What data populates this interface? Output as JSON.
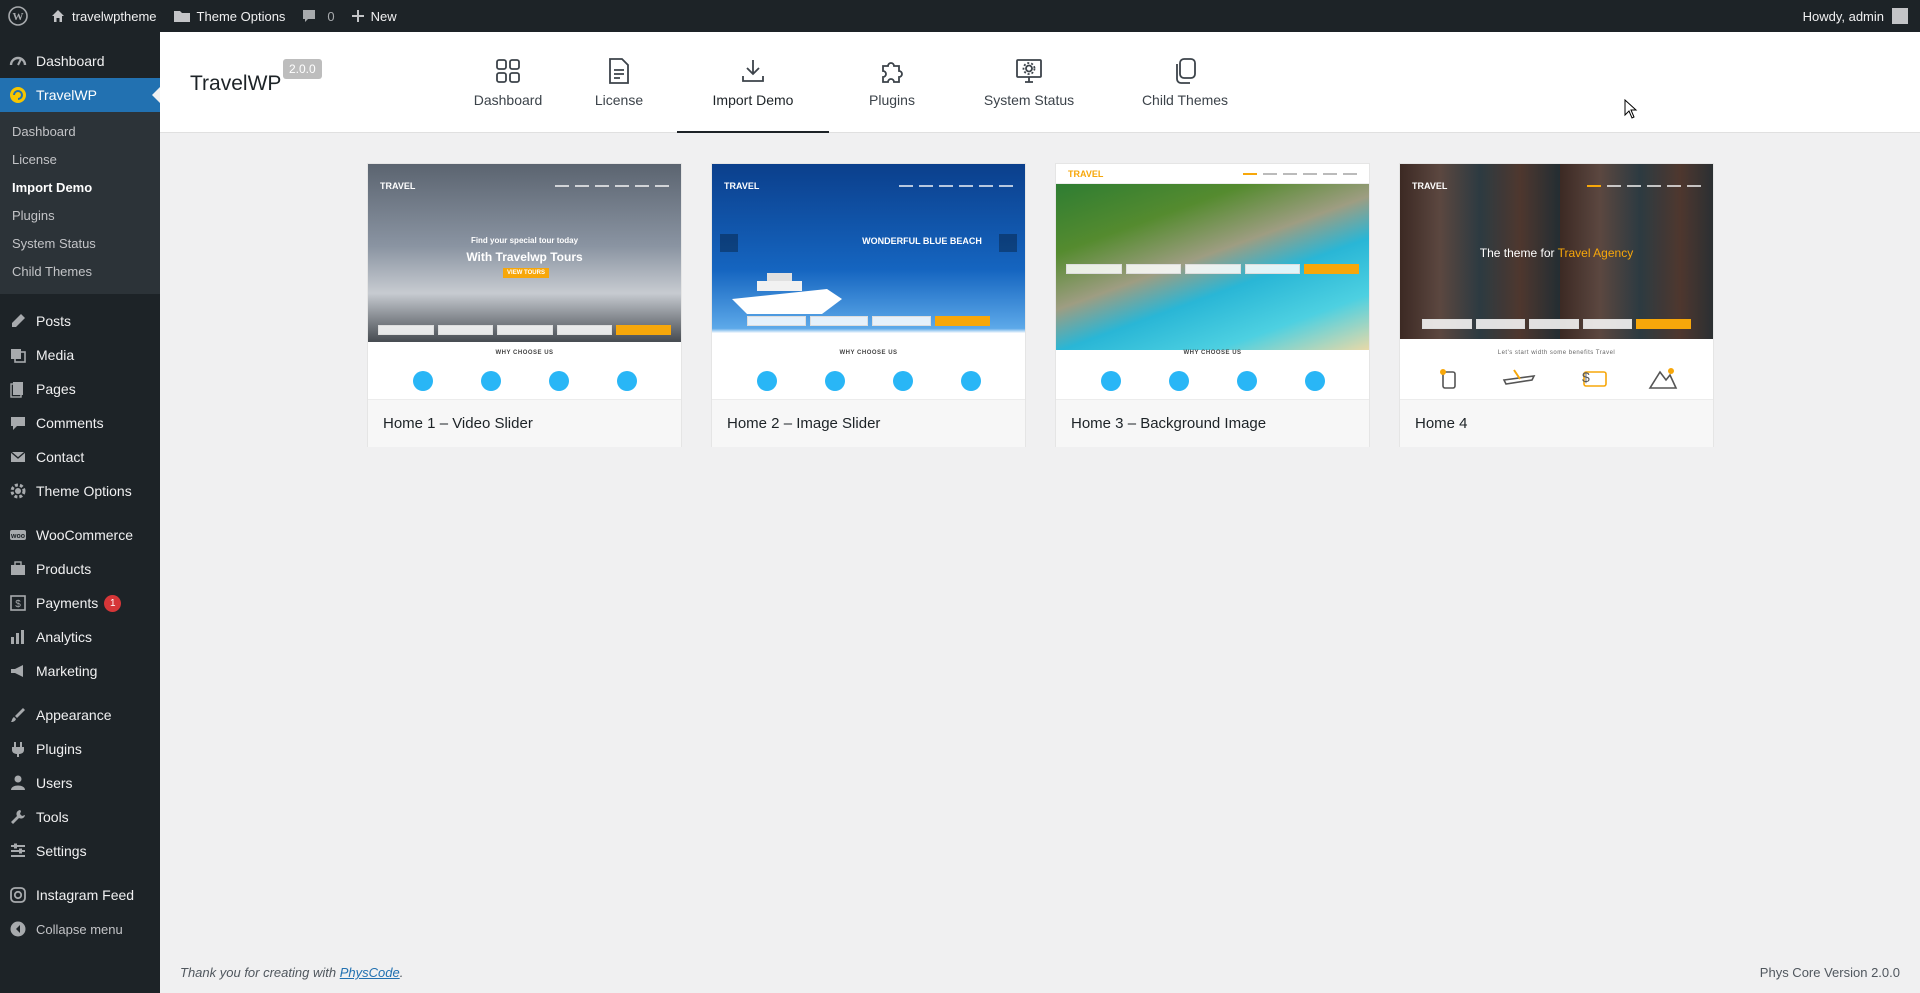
{
  "adminbar": {
    "site_name": "travelwptheme",
    "theme_options": "Theme Options",
    "comments_count": "0",
    "new_label": "New",
    "greeting": "Howdy, admin"
  },
  "sidebar": {
    "top": [
      {
        "label": "Dashboard",
        "icon": "dashboard-icon"
      },
      {
        "label": "TravelWP",
        "icon": "travelwp-icon"
      }
    ],
    "submenu": [
      {
        "label": "Dashboard"
      },
      {
        "label": "License"
      },
      {
        "label": "Import Demo"
      },
      {
        "label": "Plugins"
      },
      {
        "label": "System Status"
      },
      {
        "label": "Child Themes"
      }
    ],
    "group1": [
      {
        "label": "Posts",
        "icon": "posts-icon"
      },
      {
        "label": "Media",
        "icon": "media-icon"
      },
      {
        "label": "Pages",
        "icon": "pages-icon"
      },
      {
        "label": "Comments",
        "icon": "comments-icon"
      },
      {
        "label": "Contact",
        "icon": "contact-icon"
      },
      {
        "label": "Theme Options",
        "icon": "gear-icon"
      }
    ],
    "group2": [
      {
        "label": "WooCommerce",
        "icon": "woocommerce-icon"
      },
      {
        "label": "Products",
        "icon": "products-icon"
      },
      {
        "label": "Payments",
        "icon": "payments-icon",
        "badge": "1"
      },
      {
        "label": "Analytics",
        "icon": "analytics-icon"
      },
      {
        "label": "Marketing",
        "icon": "marketing-icon"
      }
    ],
    "group3": [
      {
        "label": "Appearance",
        "icon": "appearance-icon"
      },
      {
        "label": "Plugins",
        "icon": "plugins-icon"
      },
      {
        "label": "Users",
        "icon": "users-icon"
      },
      {
        "label": "Tools",
        "icon": "tools-icon"
      },
      {
        "label": "Settings",
        "icon": "settings-icon"
      }
    ],
    "group4": [
      {
        "label": "Instagram Feed",
        "icon": "instagram-icon"
      },
      {
        "label": "Collapse menu",
        "icon": "collapse-icon"
      }
    ]
  },
  "header": {
    "brand": "TravelWP",
    "version": "2.0.0",
    "tabs": [
      {
        "label": "Dashboard",
        "icon": "grid-icon"
      },
      {
        "label": "License",
        "icon": "license-icon"
      },
      {
        "label": "Import Demo",
        "icon": "download-icon"
      },
      {
        "label": "Plugins",
        "icon": "puzzle-icon"
      },
      {
        "label": "System Status",
        "icon": "monitor-gear-icon"
      },
      {
        "label": "Child Themes",
        "icon": "copy-icon"
      }
    ]
  },
  "demos": [
    {
      "title": "Home 1 – Video Slider",
      "logo": "TRAVEL",
      "hero_line1": "Find your special tour today",
      "hero_line2": "With Travelwp Tours",
      "cta": "VIEW TOURS",
      "why": "WHY CHOOSE US"
    },
    {
      "title": "Home 2 – Image Slider",
      "logo": "TRAVEL",
      "hero_line1": "WONDERFUL BLUE BEACH",
      "why": "WHY CHOOSE US"
    },
    {
      "title": "Home 3 – Background Image",
      "logo": "TRAVEL",
      "why": "WHY CHOOSE US"
    },
    {
      "title": "Home 4",
      "logo": "TRAVEL",
      "hero_prefix": "The theme for ",
      "hero_highlight": "Travel Agency",
      "sub": "Let's start width some benefits Travel"
    }
  ],
  "footer": {
    "left_prefix": "Thank you for creating with ",
    "left_link": "PhysCode",
    "left_suffix": ".",
    "right": "Phys Core Version 2.0.0"
  },
  "colors": {
    "admin_dark": "#1d2327",
    "accent_blue": "#2271b1",
    "badge_red": "#d63638",
    "cta_orange": "#f7a70a",
    "feature_blue": "#29b6f6"
  }
}
